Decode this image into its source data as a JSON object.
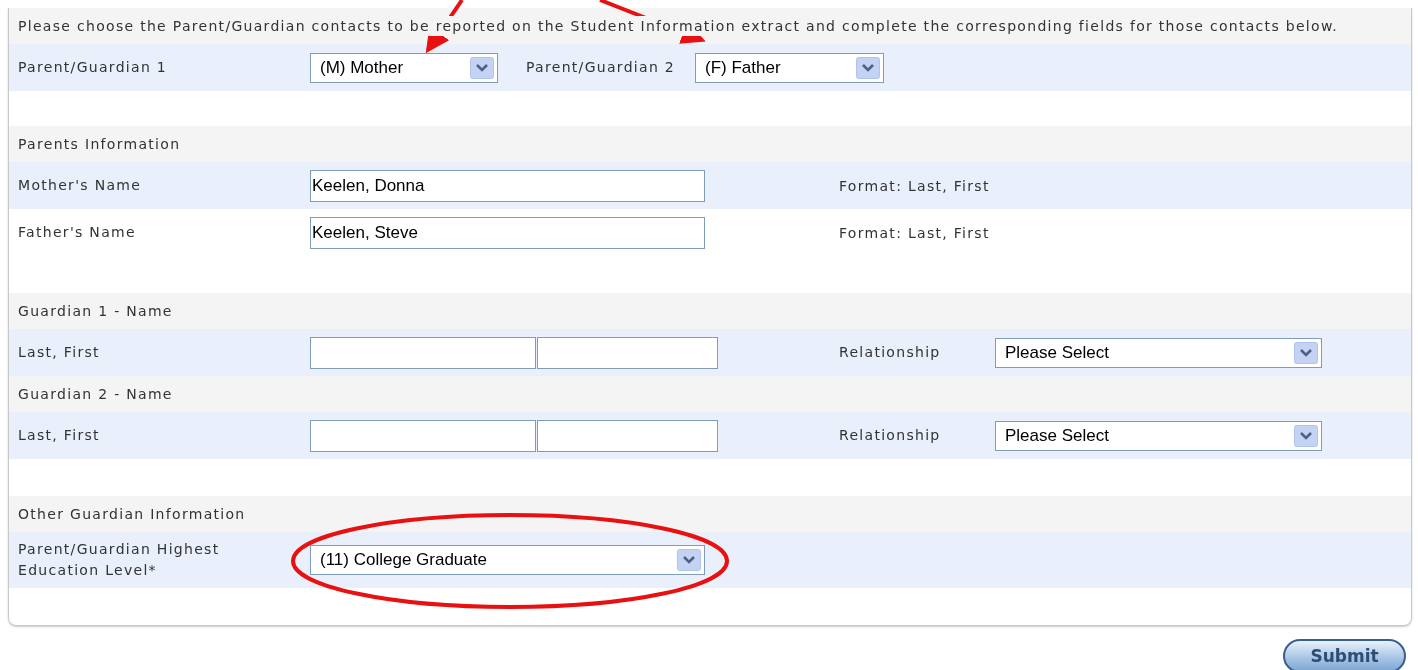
{
  "instructions": "Please choose the Parent/Guardian contacts to be reported on the Student Information extract and complete the corresponding fields for those contacts below.",
  "contact_choice": [
    {
      "label": "Parent/Guardian 1",
      "value": "(M) Mother"
    },
    {
      "label": "Parent/Guardian 2",
      "value": "(F) Father"
    }
  ],
  "sections": [
    {
      "title": "Parents Information",
      "rows": [
        {
          "kind": "name",
          "label": "Mother's Name",
          "value": "Keelen, Donna",
          "hint": "Format: Last, First"
        },
        {
          "kind": "name",
          "label": "Father's Name",
          "value": "Keelen, Steve",
          "hint": "Format: Last, First"
        }
      ]
    },
    {
      "title": "Guardian 1 - Name",
      "rows": [
        {
          "kind": "split",
          "label": "Last, First",
          "relationship_label": "Relationship",
          "relationship": "Please Select"
        }
      ]
    },
    {
      "title": "Guardian 2 - Name",
      "rows": [
        {
          "kind": "split",
          "label": "Last, First",
          "relationship_label": "Relationship",
          "relationship": "Please Select"
        }
      ]
    },
    {
      "title": "Other Guardian Information",
      "rows": [
        {
          "kind": "select",
          "label": "Parent/Guardian Highest Education Level*",
          "value": "(11) College Graduate"
        }
      ]
    }
  ],
  "submit": "Submit"
}
